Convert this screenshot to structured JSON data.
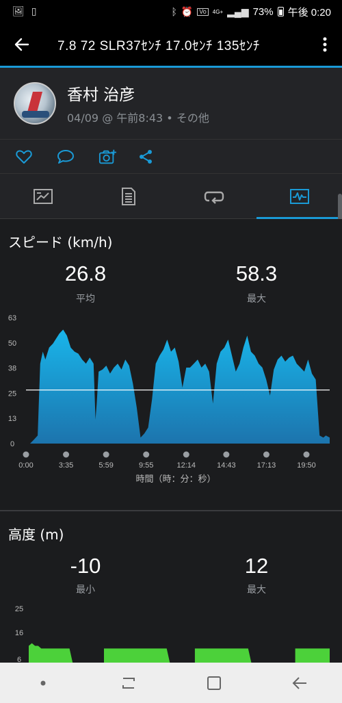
{
  "status_bar": {
    "battery": "73%",
    "time": "午後 0:20",
    "network": "4G+"
  },
  "header": {
    "title": "7.8   72   SLR37ｾﾝﾁ   17.0ｾﾝﾁ  135ｾﾝﾁ"
  },
  "activity": {
    "name": "香村 治彦",
    "subtitle": "04/09 @ 午前8:43 • その他"
  },
  "tabs": [
    {
      "icon": "summary-chart-icon",
      "active": false
    },
    {
      "icon": "details-list-icon",
      "active": false
    },
    {
      "icon": "laps-loop-icon",
      "active": false
    },
    {
      "icon": "graph-icon",
      "active": true
    }
  ],
  "accent": "#1a9ad6",
  "speed": {
    "title": "スピード (km/h)",
    "avg_value": "26.8",
    "avg_label": "平均",
    "max_value": "58.3",
    "max_label": "最大"
  },
  "altitude": {
    "title": "高度 (m)",
    "min_value": "-10",
    "min_label": "最小",
    "max_value": "12",
    "max_label": "最大"
  },
  "chart_data": [
    {
      "type": "area",
      "title": "スピード (km/h)",
      "xlabel": "時間（時：分：秒）",
      "ylabel": "",
      "ylim": [
        0,
        63
      ],
      "yticks": [
        "63",
        "50",
        "38",
        "25",
        "13",
        "0"
      ],
      "xticks": [
        "0:00",
        "3:35",
        "5:59",
        "9:55",
        "12:14",
        "14:43",
        "17:13",
        "19:50"
      ],
      "reference_line": 26.8,
      "color": "#1aa3dc",
      "x_minutes": [
        0.0,
        0.3,
        0.6,
        0.8,
        1.0,
        1.2,
        1.5,
        1.8,
        2.0,
        2.3,
        2.6,
        2.9,
        3.2,
        3.5,
        3.8,
        4.1,
        4.4,
        4.7,
        5.0,
        5.15,
        5.25,
        5.4,
        5.7,
        6.0,
        6.3,
        6.6,
        6.9,
        7.2,
        7.5,
        7.8,
        8.1,
        8.4,
        8.7,
        9.0,
        9.3,
        9.6,
        9.9,
        10.2,
        10.5,
        10.8,
        11.1,
        11.4,
        11.7,
        12.0,
        12.3,
        12.6,
        12.9,
        13.2,
        13.5,
        13.8,
        14.1,
        14.4,
        14.7,
        15.0,
        15.3,
        15.6,
        15.9,
        16.2,
        16.5,
        16.8,
        17.1,
        17.4,
        17.7,
        18.0,
        18.3,
        18.6,
        18.9,
        19.2,
        19.5,
        19.8,
        20.1,
        20.4,
        20.7,
        21.0,
        21.3,
        21.6,
        21.9,
        22.2,
        22.5,
        22.8,
        23.1,
        23.3,
        23.6
      ],
      "values": [
        0,
        2,
        4,
        40,
        46,
        42,
        48,
        50,
        52,
        55,
        57,
        54,
        48,
        46,
        45,
        42,
        40,
        43,
        40,
        12,
        20,
        36,
        37,
        39,
        35,
        38,
        40,
        37,
        42,
        39,
        30,
        18,
        3,
        5,
        8,
        22,
        40,
        44,
        47,
        52,
        46,
        48,
        41,
        28,
        38,
        38,
        40,
        42,
        38,
        40,
        36,
        20,
        40,
        46,
        48,
        52,
        44,
        36,
        40,
        48,
        54,
        46,
        44,
        40,
        38,
        32,
        24,
        37,
        42,
        44,
        41,
        43,
        44,
        40,
        38,
        36,
        42,
        35,
        32,
        4,
        3,
        4,
        3
      ]
    },
    {
      "type": "area",
      "title": "高度 (m)",
      "ylim": [
        -10,
        25
      ],
      "yticks": [
        "25",
        "16",
        "6"
      ],
      "color": "#4cd13a",
      "x_minutes": [
        0.0,
        0.3,
        0.6,
        0.9,
        1.2,
        1.5,
        1.8,
        2.1,
        2.4,
        2.7,
        3.0,
        3.3,
        3.6,
        3.9,
        4.2,
        4.5,
        4.8,
        5.1,
        5.4,
        5.7,
        6.0,
        6.3,
        6.6,
        6.9,
        7.2,
        7.5,
        7.8,
        8.1,
        8.4,
        8.7,
        9.0,
        9.3,
        9.6,
        9.9,
        10.2,
        10.5,
        10.8,
        11.1,
        11.4,
        11.7,
        12.0,
        12.3,
        12.6,
        12.9,
        13.2,
        13.5,
        13.8,
        14.1,
        14.4,
        14.7,
        15.0,
        15.3,
        15.6,
        15.9,
        16.2,
        16.5,
        16.8,
        17.1,
        17.4,
        17.7,
        18.0,
        18.3,
        18.6,
        18.9,
        19.2,
        19.5,
        19.8,
        20.1,
        20.4,
        20.7,
        21.0,
        21.3,
        21.6,
        21.9,
        22.2,
        22.5,
        22.8,
        23.1,
        23.4,
        23.7,
        24.0,
        24.3,
        24.6,
        24.9,
        25.2,
        25.5,
        25.8,
        26.1,
        26.4,
        26.7,
        27.0,
        27.3,
        27.6,
        27.9,
        28.2,
        28.5,
        28.8
      ],
      "values": [
        11,
        12,
        11,
        11,
        10,
        10,
        10,
        10,
        10,
        10,
        10,
        10,
        10,
        10,
        10,
        10,
        10,
        10,
        10,
        10,
        10,
        11,
        10,
        10,
        10,
        10,
        10,
        10,
        10,
        10,
        10,
        10,
        10,
        10,
        10,
        10,
        10,
        10,
        10,
        10,
        10,
        10,
        10,
        10,
        10,
        10,
        10,
        10,
        10,
        10,
        10,
        10,
        10,
        10,
        10,
        10,
        10,
        10,
        10,
        10,
        10,
        10,
        10,
        10,
        10,
        10,
        10,
        10,
        10,
        10,
        10,
        10,
        10,
        10,
        10,
        10,
        10,
        10,
        10,
        10,
        10,
        10,
        10,
        10,
        10,
        10,
        10,
        10,
        10,
        10,
        10,
        10,
        10,
        10,
        10,
        10,
        10,
        10
      ]
    }
  ]
}
